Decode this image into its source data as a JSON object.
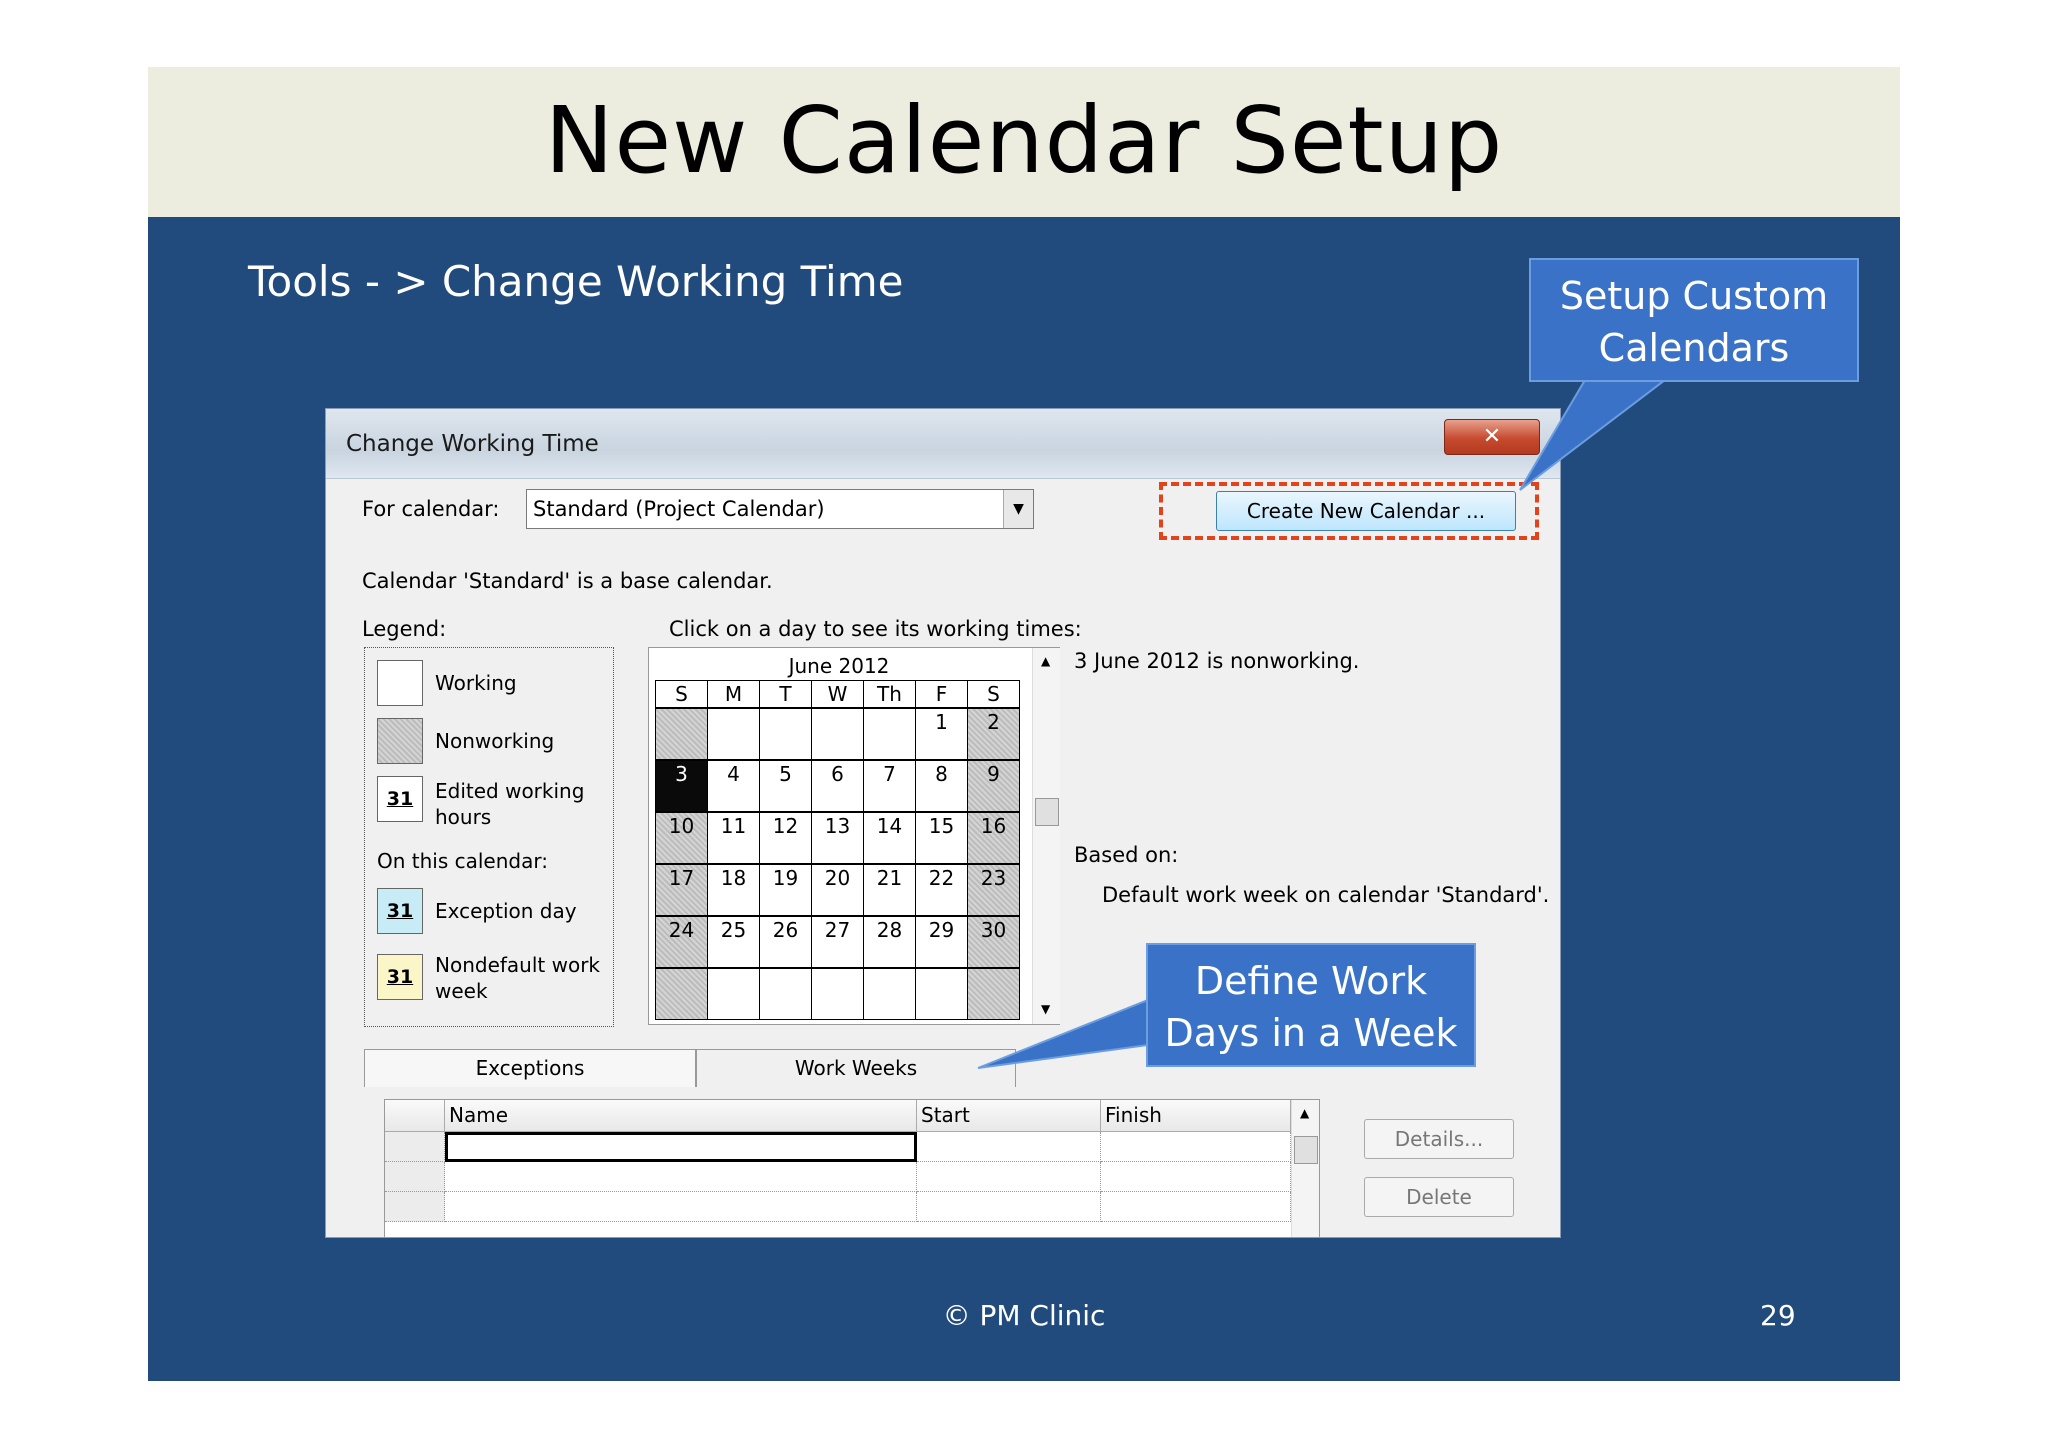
{
  "slide": {
    "title": "New Calendar Setup",
    "subtitle": "Tools - > Change Working Time",
    "footer": "© PM Clinic",
    "page_number": "29",
    "colors": {
      "background": "#214a7d",
      "title_band": "#ececdf",
      "callout": "#3a72c7",
      "highlight_dash": "#e2431a"
    }
  },
  "callouts": {
    "setup_custom": "Setup Custom\nCalendars",
    "define_work": "Define Work\nDays in a Week"
  },
  "dialog": {
    "title": "Change Working Time",
    "close_icon": "close-icon",
    "for_calendar_label": "For calendar:",
    "calendar_value": "Standard (Project Calendar)",
    "create_button": "Create New Calendar ...",
    "base_note": "Calendar 'Standard' is a base calendar.",
    "legend_label": "Legend:",
    "click_hint": "Click on a day to see its working times:",
    "legend": {
      "working": "Working",
      "nonworking": "Nonworking",
      "edited": "Edited working hours",
      "on_this_calendar": "On this calendar:",
      "exception": "Exception day",
      "nondefault": "Nondefault work week",
      "swatch_day": "31"
    },
    "calendar": {
      "month": "June 2012",
      "weekdays": [
        "S",
        "M",
        "T",
        "W",
        "Th",
        "F",
        "S"
      ],
      "weeks": [
        [
          "",
          "",
          "",
          "",
          "",
          "1",
          "2"
        ],
        [
          "3",
          "4",
          "5",
          "6",
          "7",
          "8",
          "9"
        ],
        [
          "10",
          "11",
          "12",
          "13",
          "14",
          "15",
          "16"
        ],
        [
          "17",
          "18",
          "19",
          "20",
          "21",
          "22",
          "23"
        ],
        [
          "24",
          "25",
          "26",
          "27",
          "28",
          "29",
          "30"
        ],
        [
          "",
          "",
          "",
          "",
          "",
          "",
          ""
        ]
      ],
      "selected_day": "3"
    },
    "status_text": "3 June 2012 is nonworking.",
    "based_on_label": "Based on:",
    "based_on_value": "Default work week on calendar 'Standard'.",
    "tabs": [
      "Exceptions",
      "Work Weeks"
    ],
    "grid_columns": [
      "Name",
      "Start",
      "Finish"
    ],
    "details_button": "Details...",
    "delete_button": "Delete"
  }
}
